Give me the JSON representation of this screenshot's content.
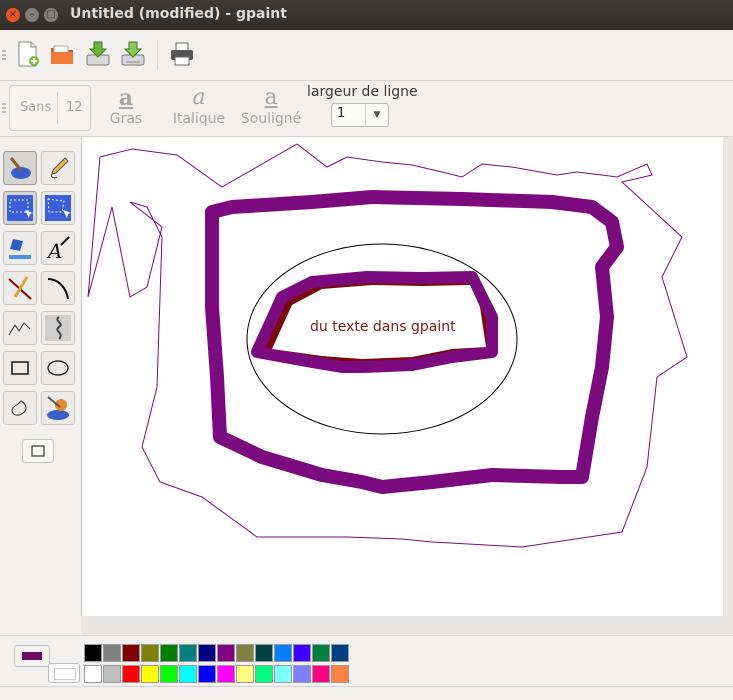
{
  "window": {
    "title": "Untitled (modified) - gpaint",
    "controls": {
      "close_glyph": "×",
      "minimize_glyph": "–",
      "maximize_glyph": "□"
    }
  },
  "toolbar": {
    "buttons": [
      {
        "name": "new-file-button",
        "icon": "new-document-icon"
      },
      {
        "name": "open-file-button",
        "icon": "folder-open-icon"
      },
      {
        "name": "save-button",
        "icon": "save-download-icon"
      },
      {
        "name": "save-as-button",
        "icon": "save-as-icon"
      },
      {
        "name": "print-button",
        "icon": "printer-icon"
      }
    ]
  },
  "text_toolbar": {
    "font_name": "Sans",
    "font_size": "12",
    "bold_icon": "a",
    "bold_label": "Gras",
    "italic_icon": "a",
    "italic_label": "Italique",
    "underline_icon": "a",
    "underline_label": "Souligné",
    "line_width_label": "largeur de ligne",
    "line_width_value": "1",
    "dropdown_glyph": "▼"
  },
  "toolbox": {
    "tools": [
      "paint-brush-icon",
      "pencil-icon",
      "lasso-select-icon",
      "rect-select-icon",
      "eraser-icon",
      "text-tool-icon",
      "line-tool-icon",
      "curve-tool-icon",
      "polyline-tool-icon",
      "freehand-tool-icon",
      "rectangle-tool-icon",
      "ellipse-tool-icon",
      "closed-freehand-icon",
      "paint-bucket-icon"
    ]
  },
  "canvas": {
    "text": "du texte dans gpaint",
    "colors": {
      "thick_stroke": "#7b0a7e",
      "thin_stroke": "#7b0a7e",
      "text_fill": "#7a0a0a",
      "ellipse": "#000000"
    }
  },
  "palette": {
    "foreground": "#6d0a6f",
    "background": "#ffffff",
    "row1": [
      "#000000",
      "#808080",
      "#800000",
      "#808000",
      "#008000",
      "#008080",
      "#000080",
      "#800080",
      "#808040",
      "#004040",
      "#0080ff",
      "#4000ff",
      "#008040",
      "#004080"
    ],
    "row2": [
      "#ffffff",
      "#c0c0c0",
      "#ff0000",
      "#ffff00",
      "#00ff00",
      "#00ffff",
      "#0000ff",
      "#ff00ff",
      "#ffff80",
      "#00ff80",
      "#80ffff",
      "#8080ff",
      "#ff0080",
      "#ff8040"
    ]
  }
}
